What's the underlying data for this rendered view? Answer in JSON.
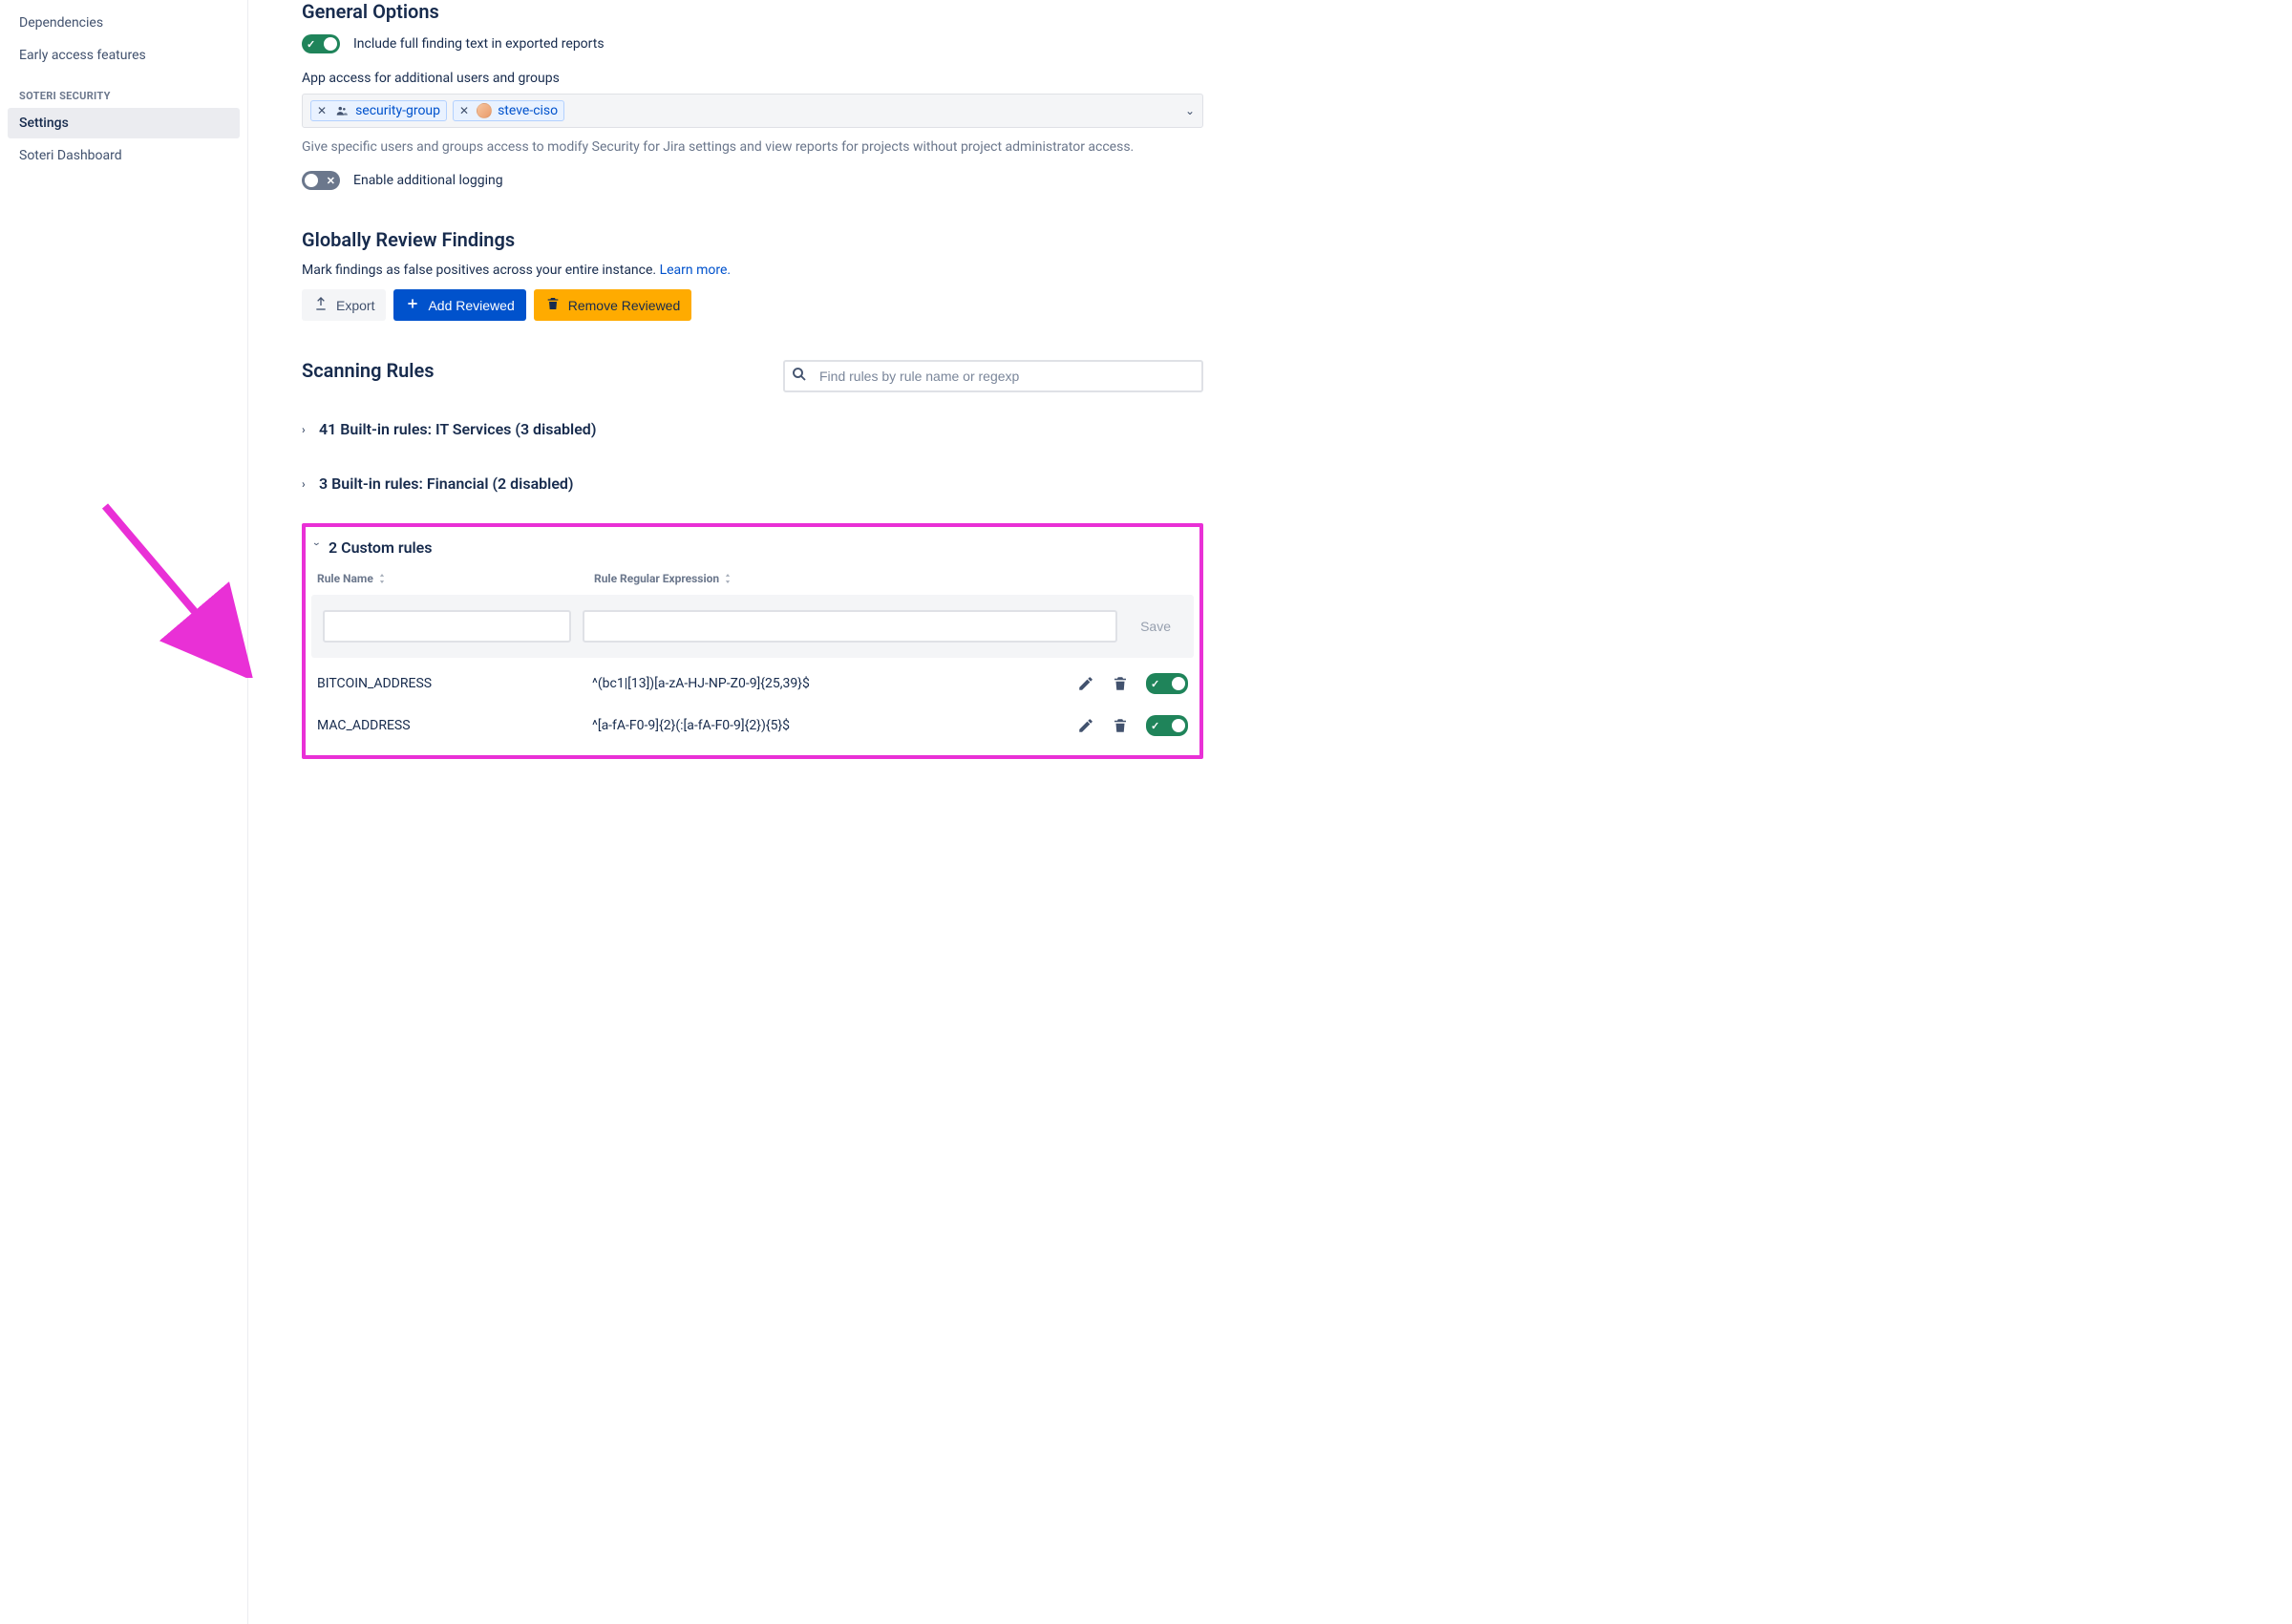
{
  "sidebar": {
    "topItems": [
      {
        "label": "Dependencies"
      },
      {
        "label": "Early access features"
      }
    ],
    "sectionHeader": "SOTERI SECURITY",
    "items": [
      {
        "label": "Settings",
        "active": true
      },
      {
        "label": "Soteri Dashboard",
        "active": false
      }
    ]
  },
  "general": {
    "title": "General Options",
    "includeFindingText": "Include full finding text in exported reports",
    "includeFindingOn": true,
    "appAccessLabel": "App access for additional users and groups",
    "chips": [
      {
        "kind": "group",
        "label": "security-group"
      },
      {
        "kind": "user",
        "label": "steve-ciso"
      }
    ],
    "helper": "Give specific users and groups access to modify Security for Jira settings and view reports for projects without project administrator access.",
    "enableLoggingLabel": "Enable additional logging",
    "enableLoggingOn": false
  },
  "review": {
    "title": "Globally Review Findings",
    "subtext": "Mark findings as false positives across your entire instance. ",
    "learnMore": "Learn more.",
    "exportLabel": "Export",
    "addReviewedLabel": "Add Reviewed",
    "removeReviewedLabel": "Remove Reviewed"
  },
  "scanning": {
    "title": "Scanning Rules",
    "searchPlaceholder": "Find rules by rule name or regexp",
    "groups": [
      {
        "label": "41 Built-in rules: IT Services (3 disabled)",
        "open": false
      },
      {
        "label": "3 Built-in rules: Financial (2 disabled)",
        "open": false
      }
    ],
    "custom": {
      "header": "2 Custom rules",
      "colName": "Rule Name",
      "colRegex": "Rule Regular Expression",
      "saveLabel": "Save",
      "rows": [
        {
          "name": "BITCOIN_ADDRESS",
          "regex": "^(bc1|[13])[a-zA-HJ-NP-Z0-9]{25,39}$",
          "enabled": true
        },
        {
          "name": "MAC_ADDRESS",
          "regex": "^[a-fA-F0-9]{2}(:[a-fA-F0-9]{2}){5}$",
          "enabled": true
        }
      ]
    }
  }
}
